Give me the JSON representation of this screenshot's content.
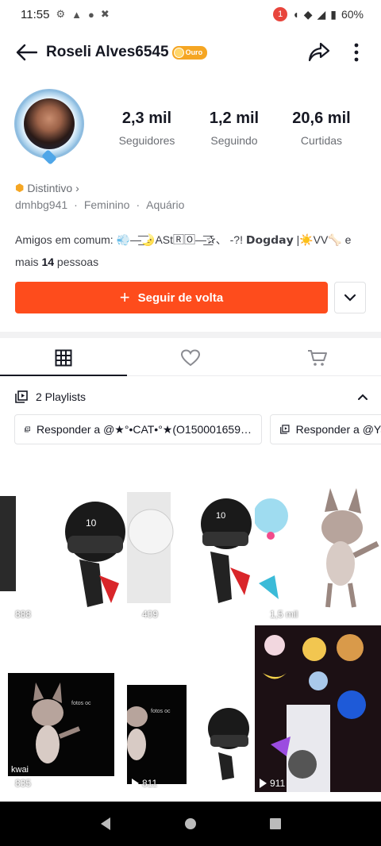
{
  "status_bar": {
    "time": "11:55",
    "notification_count": "1",
    "battery": "60%"
  },
  "header": {
    "name": "Roseli Alves6545",
    "badge_label": "Ouro"
  },
  "stats": [
    {
      "value": "2,3 mil",
      "label": "Seguidores"
    },
    {
      "value": "1,2 mil",
      "label": "Seguindo"
    },
    {
      "value": "20,6 mil",
      "label": "Curtidas"
    }
  ],
  "profile": {
    "distintivo": "Distintivo",
    "username": "dmhbg941",
    "gender": "Feminino",
    "sign": "Aquário",
    "separator": "·"
  },
  "mutual": {
    "prefix": "Amigos em comum:",
    "friends": "💨—͟͞🌛ASt🅁🄾—͟͞✰、 -?! 𝗗𝗼𝗴𝗱𝗮𝘆 |☀️VV🦴 e",
    "more_prefix": "mais",
    "more_count": "14",
    "more_suffix": "pessoas"
  },
  "actions": {
    "follow_back": "Seguir de volta"
  },
  "tabs": [
    {
      "name": "videos",
      "active": true
    },
    {
      "name": "liked",
      "active": false
    },
    {
      "name": "shop",
      "active": false
    }
  ],
  "playlists": {
    "header": "2 Playlists",
    "items": [
      {
        "label": "Responder a @★°•CAT•°★(O150001659…"
      },
      {
        "label": "Responder a @Ya"
      }
    ]
  },
  "videos": [
    {
      "views": "888"
    },
    {
      "views": "409"
    },
    {
      "views": "1,5 mil"
    },
    {
      "views": "835"
    },
    {
      "views": "811"
    },
    {
      "views": "911"
    }
  ],
  "colors": {
    "accent": "#fe4c1c",
    "badge": "#f5a623"
  }
}
